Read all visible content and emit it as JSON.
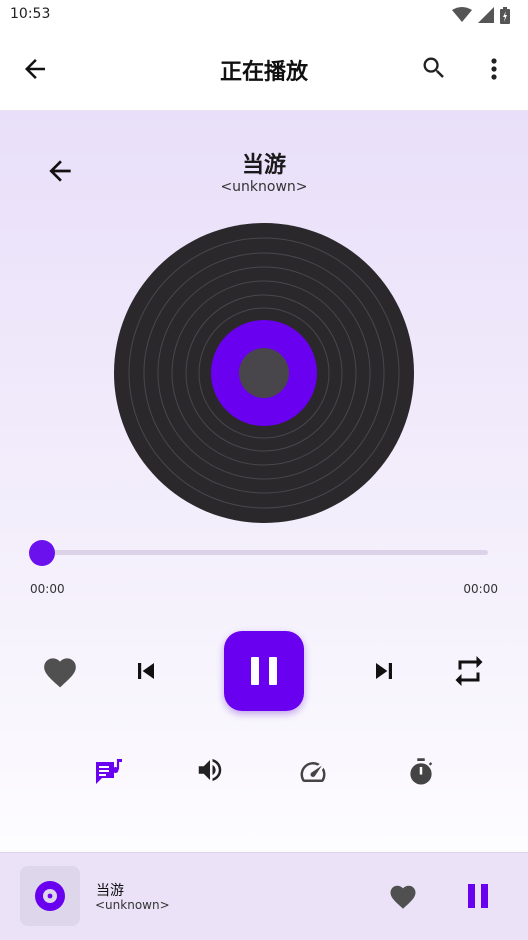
{
  "status_bar": {
    "time": "10:53",
    "icons": [
      "wifi-icon",
      "cell-signal-icon",
      "battery-icon"
    ]
  },
  "app_bar": {
    "title": "正在播放",
    "icons": [
      "back-arrow-icon",
      "search-icon",
      "more-vert-icon"
    ]
  },
  "now_playing": {
    "title": "当游",
    "artist": "<unknown>",
    "back_icon": "back-arrow-icon"
  },
  "progress": {
    "current": "00:00",
    "total": "00:00",
    "fraction": 0
  },
  "controls": {
    "icons": [
      "heart-icon",
      "skip-previous-icon",
      "pause-icon",
      "skip-next-icon",
      "repeat-icon"
    ],
    "tools": [
      "lyrics-icon",
      "volume-icon",
      "speed-icon",
      "timer-icon"
    ]
  },
  "mini_player": {
    "title": "当游",
    "artist": "<unknown>",
    "icons": [
      "disc-icon",
      "heart-icon",
      "pause-icon"
    ]
  },
  "colors": {
    "accent": "#6a00f0",
    "disc_dark": "#2a282b",
    "icon_dark": "#222222",
    "heart_gray": "#505050",
    "background_tint": "#e9dffa"
  }
}
